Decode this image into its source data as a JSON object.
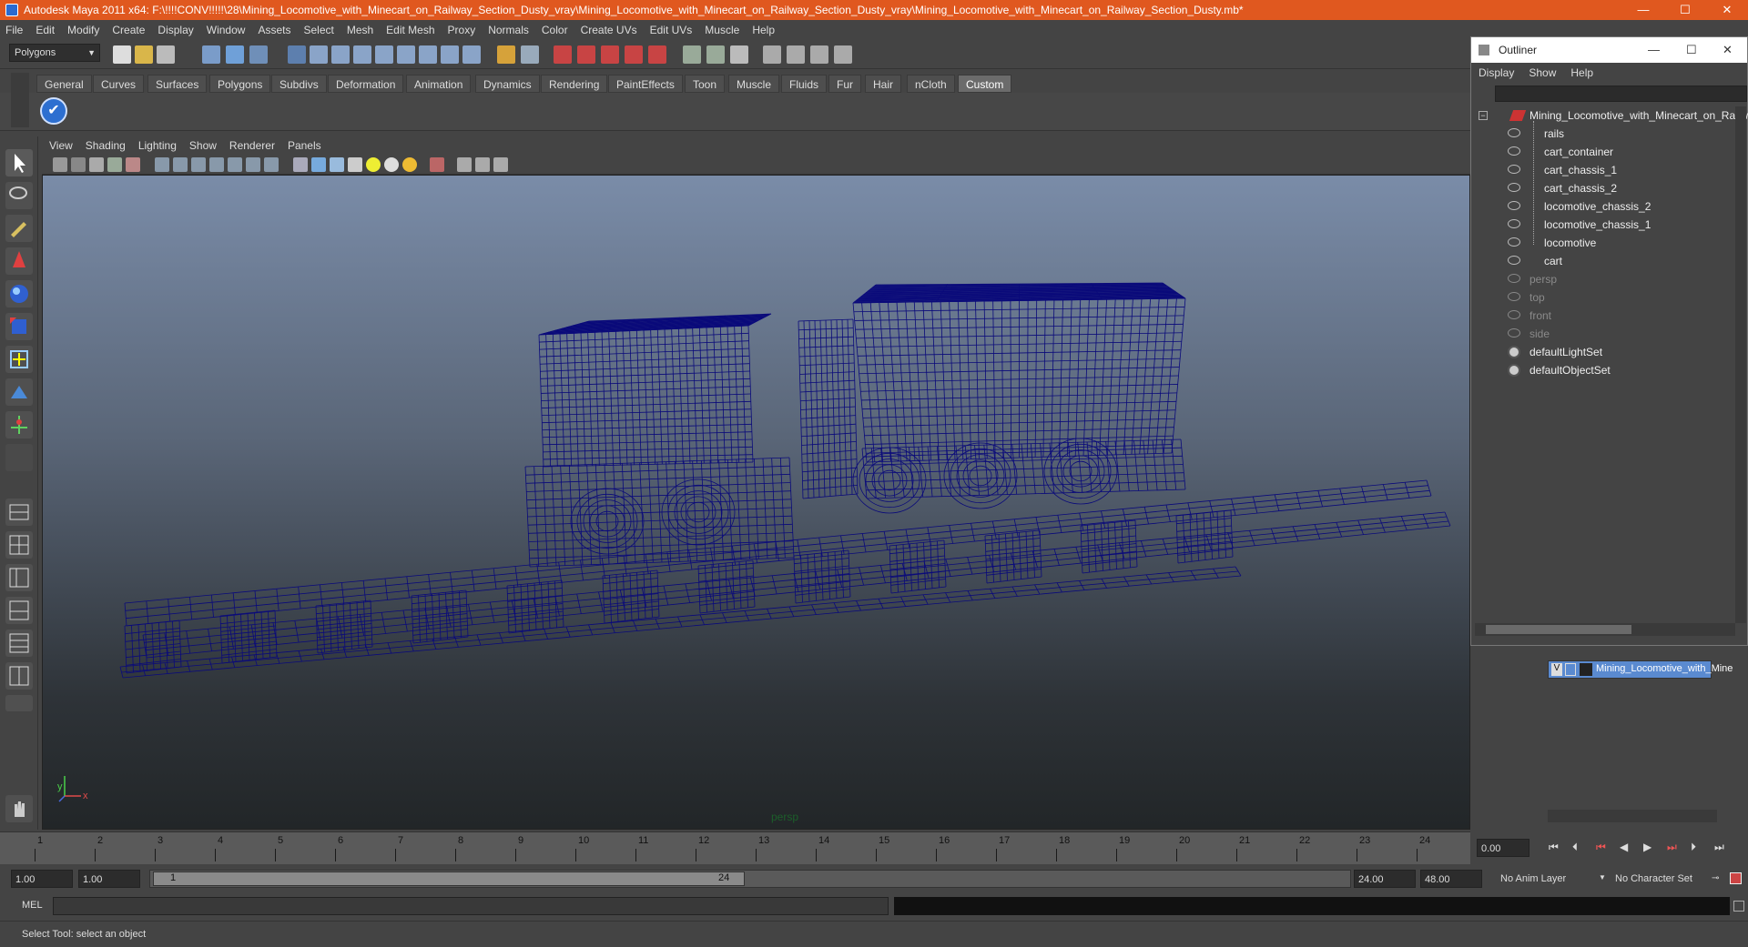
{
  "window": {
    "title": "Autodesk Maya 2011 x64: F:\\!!!!CONV!!!!!\\28\\Mining_Locomotive_with_Minecart_on_Railway_Section_Dusty_vray\\Mining_Locomotive_with_Minecart_on_Railway_Section_Dusty_vray\\Mining_Locomotive_with_Minecart_on_Railway_Section_Dusty.mb*",
    "minimize": "—",
    "maximize": "☐",
    "close": "✕"
  },
  "menubar": [
    "File",
    "Edit",
    "Modify",
    "Create",
    "Display",
    "Window",
    "Assets",
    "Select",
    "Mesh",
    "Edit Mesh",
    "Proxy",
    "Normals",
    "Color",
    "Create UVs",
    "Edit UVs",
    "Muscle",
    "Help"
  ],
  "mode_selector": "Polygons",
  "shelf_tabs": [
    "General",
    "Curves",
    "Surfaces",
    "Polygons",
    "Subdivs",
    "Deformation",
    "Animation",
    "Dynamics",
    "Rendering",
    "PaintEffects",
    "Toon",
    "Muscle",
    "Fluids",
    "Fur",
    "Hair",
    "nCloth",
    "Custom"
  ],
  "active_shelf_tab": "Custom",
  "panel_menu": [
    "View",
    "Shading",
    "Lighting",
    "Show",
    "Renderer",
    "Panels"
  ],
  "viewport": {
    "camera_label": "persp",
    "axis_y": "y",
    "axis_x": "x",
    "wire_color": "#0a0a7a"
  },
  "timeline": {
    "ticks": [
      "1",
      "2",
      "3",
      "4",
      "5",
      "6",
      "7",
      "8",
      "9",
      "10",
      "11",
      "12",
      "13",
      "14",
      "15",
      "16",
      "17",
      "18",
      "19",
      "20",
      "21",
      "22",
      "23",
      "24"
    ],
    "current_time": "0.00"
  },
  "range": {
    "start": "1.00",
    "playback_start": "1.00",
    "slider_start": "1",
    "slider_end": "24",
    "playback_end": "24.00",
    "end": "48.00",
    "anim_layer": "No Anim Layer",
    "character_set": "No Character Set"
  },
  "mel": {
    "label": "MEL"
  },
  "help_line": "Select Tool: select an object",
  "outliner": {
    "title": "Outliner",
    "menu": [
      "Display",
      "Show",
      "Help"
    ],
    "root": "Mining_Locomotive_with_Minecart_on_Railway",
    "children": [
      "rails",
      "cart_container",
      "cart_chassis_1",
      "cart_chassis_2",
      "locomotive_chassis_2",
      "locomotive_chassis_1",
      "locomotive",
      "cart"
    ],
    "cameras": [
      "persp",
      "top",
      "front",
      "side"
    ],
    "sets": [
      "defaultLightSet",
      "defaultObjectSet"
    ]
  },
  "layer": {
    "name": "Mining_Locomotive_with_Mine",
    "visible": "V"
  }
}
